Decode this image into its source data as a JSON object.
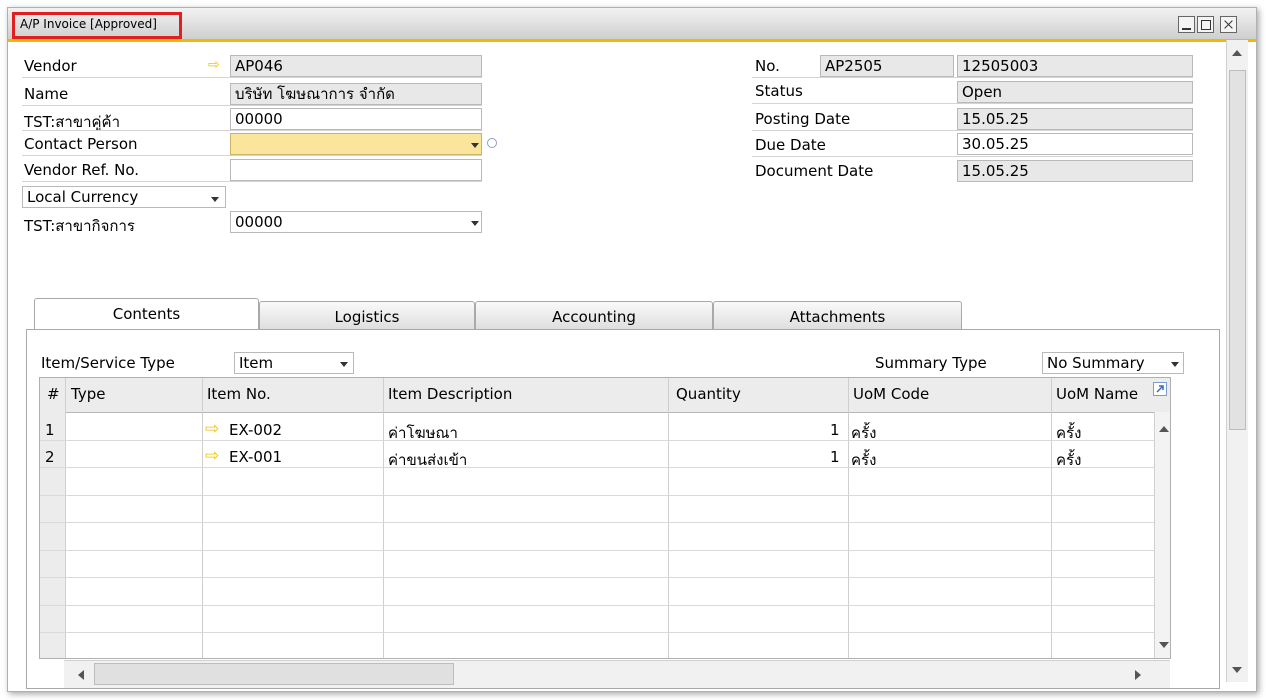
{
  "window": {
    "title": "A/P Invoice [Approved]"
  },
  "header": {
    "vendor_label": "Vendor",
    "vendor_value": "AP046",
    "name_label": "Name",
    "name_value": "บริษัท โฆษณาการ จำกัด",
    "branch_label": "TST:สาขาคู่ค้า",
    "branch_value": "00000",
    "contact_label": "Contact Person",
    "contact_value": "",
    "vendor_ref_label": "Vendor Ref. No.",
    "vendor_ref_value": "",
    "currency_value": "Local Currency",
    "business_branch_label": "TST:สาขากิจการ",
    "business_branch_value": "00000",
    "no_label": "No.",
    "series_value": "AP2505",
    "doc_number": "12505003",
    "status_label": "Status",
    "status_value": "Open",
    "posting_date_label": "Posting Date",
    "posting_date_value": "15.05.25",
    "due_date_label": "Due Date",
    "due_date_value": "30.05.25",
    "document_date_label": "Document Date",
    "document_date_value": "15.05.25"
  },
  "tabs": [
    {
      "label": "Contents",
      "active": true
    },
    {
      "label": "Logistics",
      "active": false
    },
    {
      "label": "Accounting",
      "active": false
    },
    {
      "label": "Attachments",
      "active": false
    }
  ],
  "contents": {
    "item_service_type_label": "Item/Service Type",
    "item_service_type_value": "Item",
    "summary_type_label": "Summary Type",
    "summary_type_value": "No Summary",
    "columns": [
      "#",
      "Type",
      "Item No.",
      "Item Description",
      "Quantity",
      "UoM Code",
      "UoM Name"
    ],
    "rows": [
      {
        "num": "1",
        "type": "",
        "item_no": "EX-002",
        "description": "ค่าโฆษณา",
        "quantity": "1",
        "uom_code": "ครั้ง",
        "uom_name": "ครั้ง"
      },
      {
        "num": "2",
        "type": "",
        "item_no": "EX-001",
        "description": "ค่าขนส่งเข้า",
        "quantity": "1",
        "uom_code": "ครั้ง",
        "uom_name": "ครั้ง"
      }
    ]
  },
  "icons": {
    "link_arrow": "right-arrow-icon",
    "dropdown": "chevron-down-icon",
    "contact_info": "info-circle-icon",
    "expand": "expand-icon"
  },
  "colors": {
    "title_accent": "#f5b800",
    "highlight_border": "#e02020",
    "mandatory_field": "#fbe49b",
    "link_arrow": "#f2c200"
  }
}
